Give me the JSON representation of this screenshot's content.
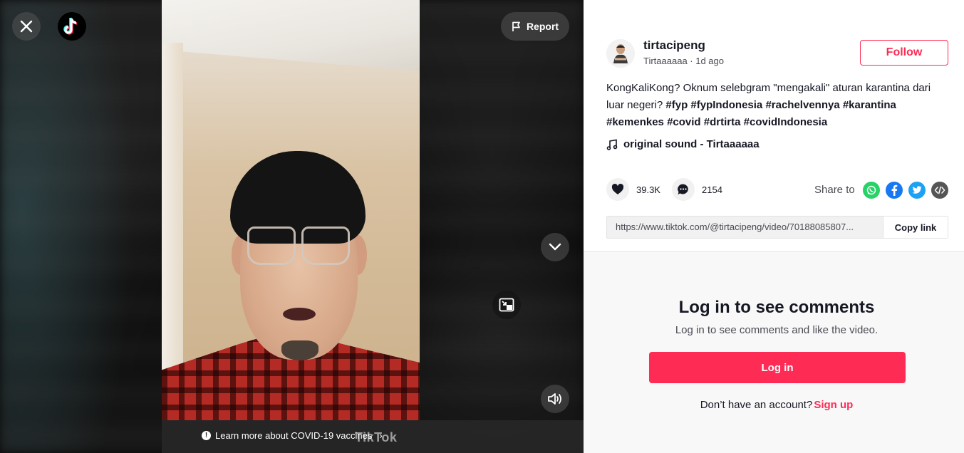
{
  "player": {
    "report_label": "Report",
    "covid_banner": "Learn more about COVID-19 vaccines",
    "watermark": "TikTok",
    "icons": {
      "close": "close-icon",
      "logo": "tiktok-logo-icon",
      "report": "flag-icon",
      "next": "chevron-down-icon",
      "pip": "picture-in-picture-icon",
      "sound": "volume-icon"
    }
  },
  "author": {
    "username": "tirtacipeng",
    "display_name": "Tirtaaaaaa",
    "separator": " · ",
    "posted": "1d ago",
    "follow_label": "Follow"
  },
  "description": {
    "text": "KongKaliKong? Oknum selebgram \"mengakali\" aturan karantina dari luar negeri?",
    "hashtags": [
      "#fyp",
      "#fypIndonesia",
      "#rachelvennya",
      "#karantina",
      "#kemenkes",
      "#covid",
      "#drtirta",
      "#covidIndonesia"
    ]
  },
  "music": {
    "label": "original sound - Tirtaaaaaa"
  },
  "stats": {
    "likes": "39.3K",
    "comments": "2154"
  },
  "share": {
    "label": "Share to",
    "targets": [
      "whatsapp-icon",
      "facebook-icon",
      "twitter-icon",
      "embed-icon"
    ],
    "colors": {
      "whatsapp": "#25D366",
      "facebook": "#1877F2",
      "twitter": "#1DA1F2",
      "embed": "#555555"
    }
  },
  "link": {
    "url": "https://www.tiktok.com/@tirtacipeng/video/70188085807...",
    "copy_label": "Copy link"
  },
  "comments": {
    "title": "Log in to see comments",
    "subtitle": "Log in to see comments and like the video.",
    "login_label": "Log in",
    "no_account": "Don’t have an account?",
    "signup_label": "Sign up"
  },
  "colors": {
    "accent": "#FE2C55",
    "text": "#161823"
  }
}
